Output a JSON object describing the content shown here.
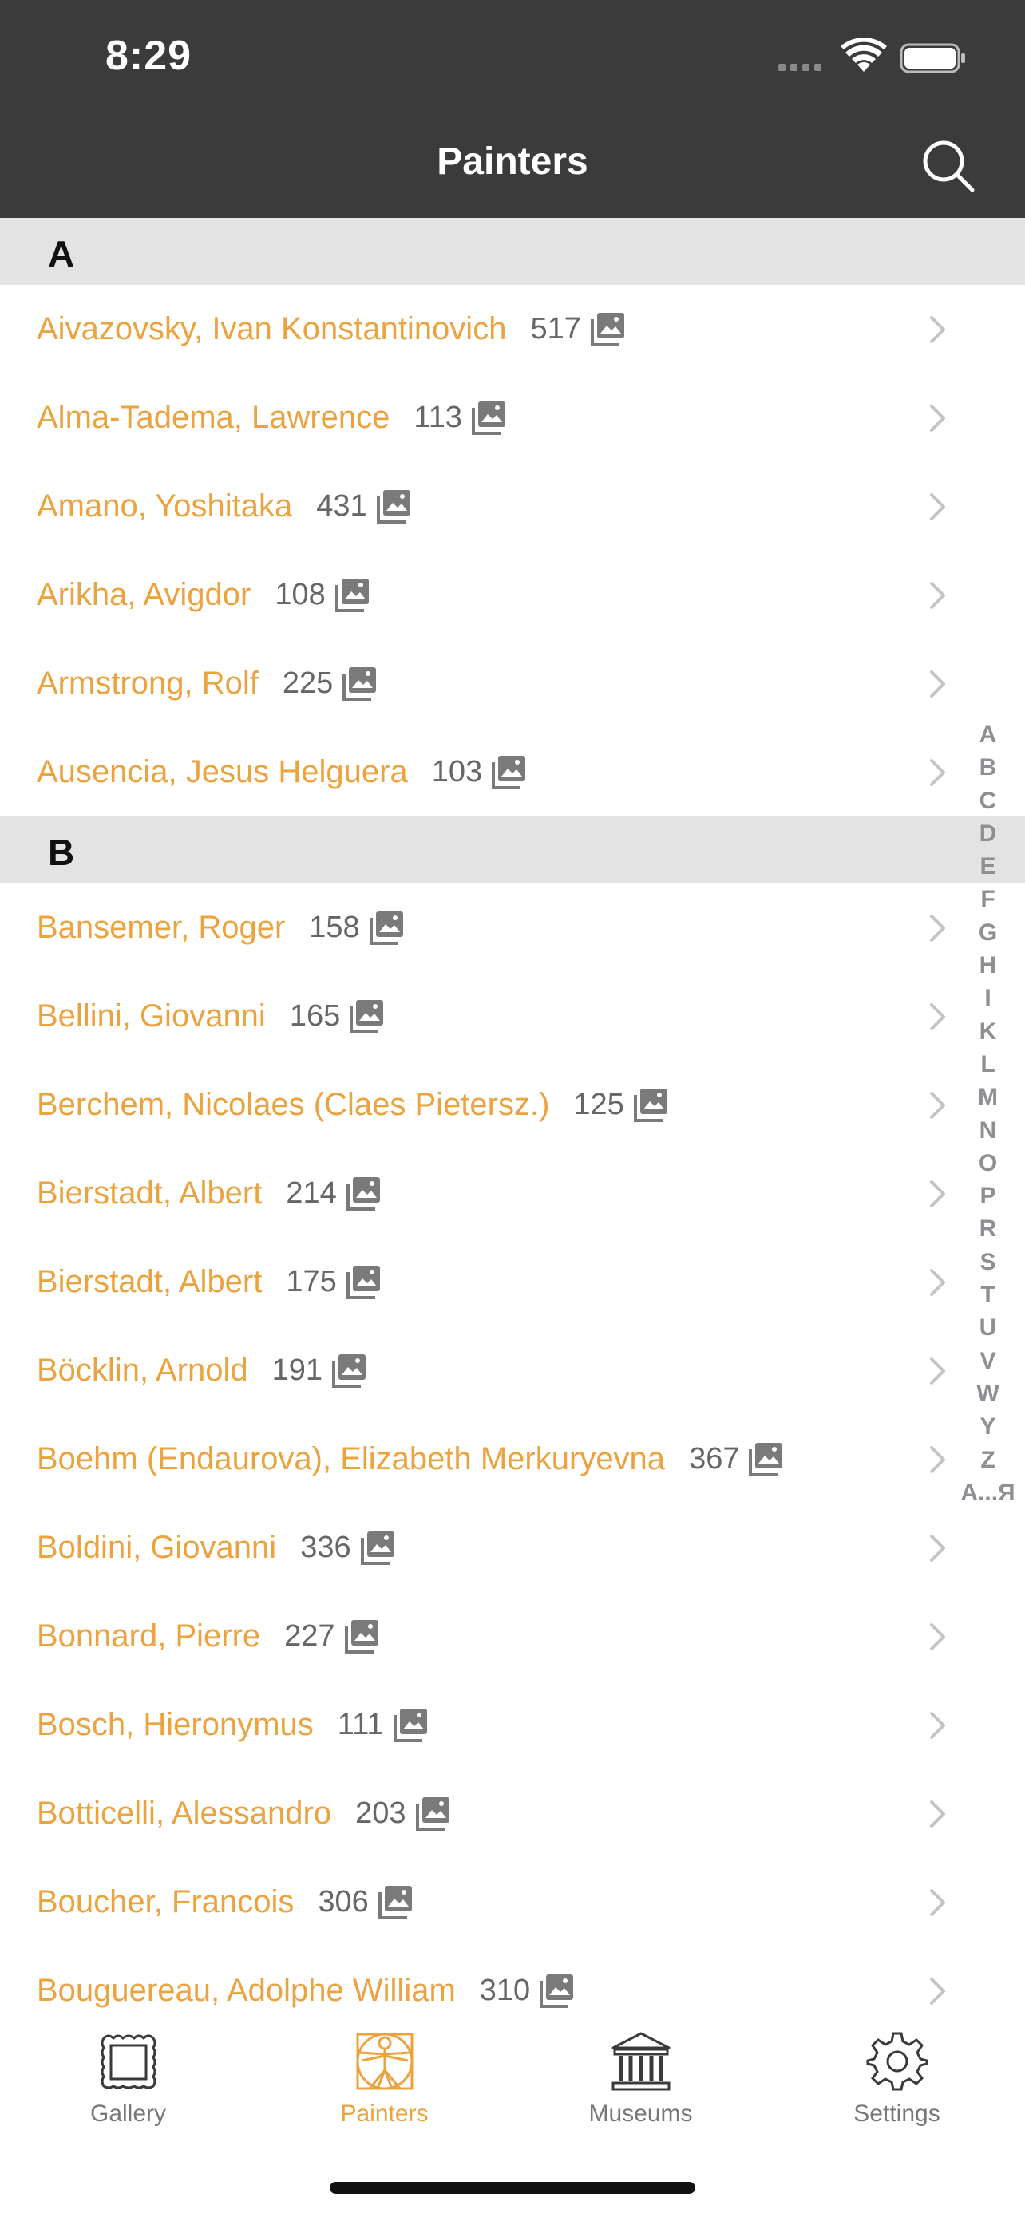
{
  "status": {
    "time": "8:29"
  },
  "nav": {
    "title": "Painters"
  },
  "sections": [
    {
      "letter": "A",
      "rows": [
        {
          "name": "Aivazovsky, Ivan Konstantinovich",
          "count": "517"
        },
        {
          "name": "Alma-Tadema, Lawrence",
          "count": "113"
        },
        {
          "name": "Amano, Yoshitaka",
          "count": "431"
        },
        {
          "name": "Arikha, Avigdor",
          "count": "108"
        },
        {
          "name": "Armstrong, Rolf",
          "count": "225"
        },
        {
          "name": "Ausencia, Jesus Helguera",
          "count": "103"
        }
      ]
    },
    {
      "letter": "B",
      "rows": [
        {
          "name": "Bansemer, Roger",
          "count": "158"
        },
        {
          "name": "Bellini, Giovanni",
          "count": "165"
        },
        {
          "name": "Berchem, Nicolaes (Claes Pietersz.)",
          "count": "125"
        },
        {
          "name": "Bierstadt, Albert",
          "count": "214"
        },
        {
          "name": "Bierstadt, Albert",
          "count": "175"
        },
        {
          "name": "Böcklin, Arnold",
          "count": "191"
        },
        {
          "name": "Boehm (Endaurova), Elizabeth Merkuryevna",
          "count": "367"
        },
        {
          "name": "Boldini, Giovanni",
          "count": "336"
        },
        {
          "name": "Bonnard, Pierre",
          "count": "227"
        },
        {
          "name": "Bosch, Hieronymus",
          "count": "111"
        },
        {
          "name": "Botticelli, Alessandro",
          "count": "203"
        },
        {
          "name": "Boucher, Francois",
          "count": "306"
        },
        {
          "name": "Bouguereau, Adolphe William",
          "count": "310"
        }
      ]
    }
  ],
  "index_letters": [
    "A",
    "B",
    "C",
    "D",
    "E",
    "F",
    "G",
    "H",
    "I",
    "K",
    "L",
    "M",
    "N",
    "O",
    "P",
    "R",
    "S",
    "T",
    "U",
    "V",
    "W",
    "Y",
    "Z",
    "А...Я"
  ],
  "tabs": [
    {
      "label": "Gallery",
      "icon": "frame-icon",
      "active": false
    },
    {
      "label": "Painters",
      "icon": "vitruvian-man-icon",
      "active": true
    },
    {
      "label": "Museums",
      "icon": "museum-icon",
      "active": false
    },
    {
      "label": "Settings",
      "icon": "gear-icon",
      "active": false
    }
  ],
  "colors": {
    "accent": "#eba340",
    "bar": "#3b3b3b",
    "section": "#e3e3e3"
  }
}
